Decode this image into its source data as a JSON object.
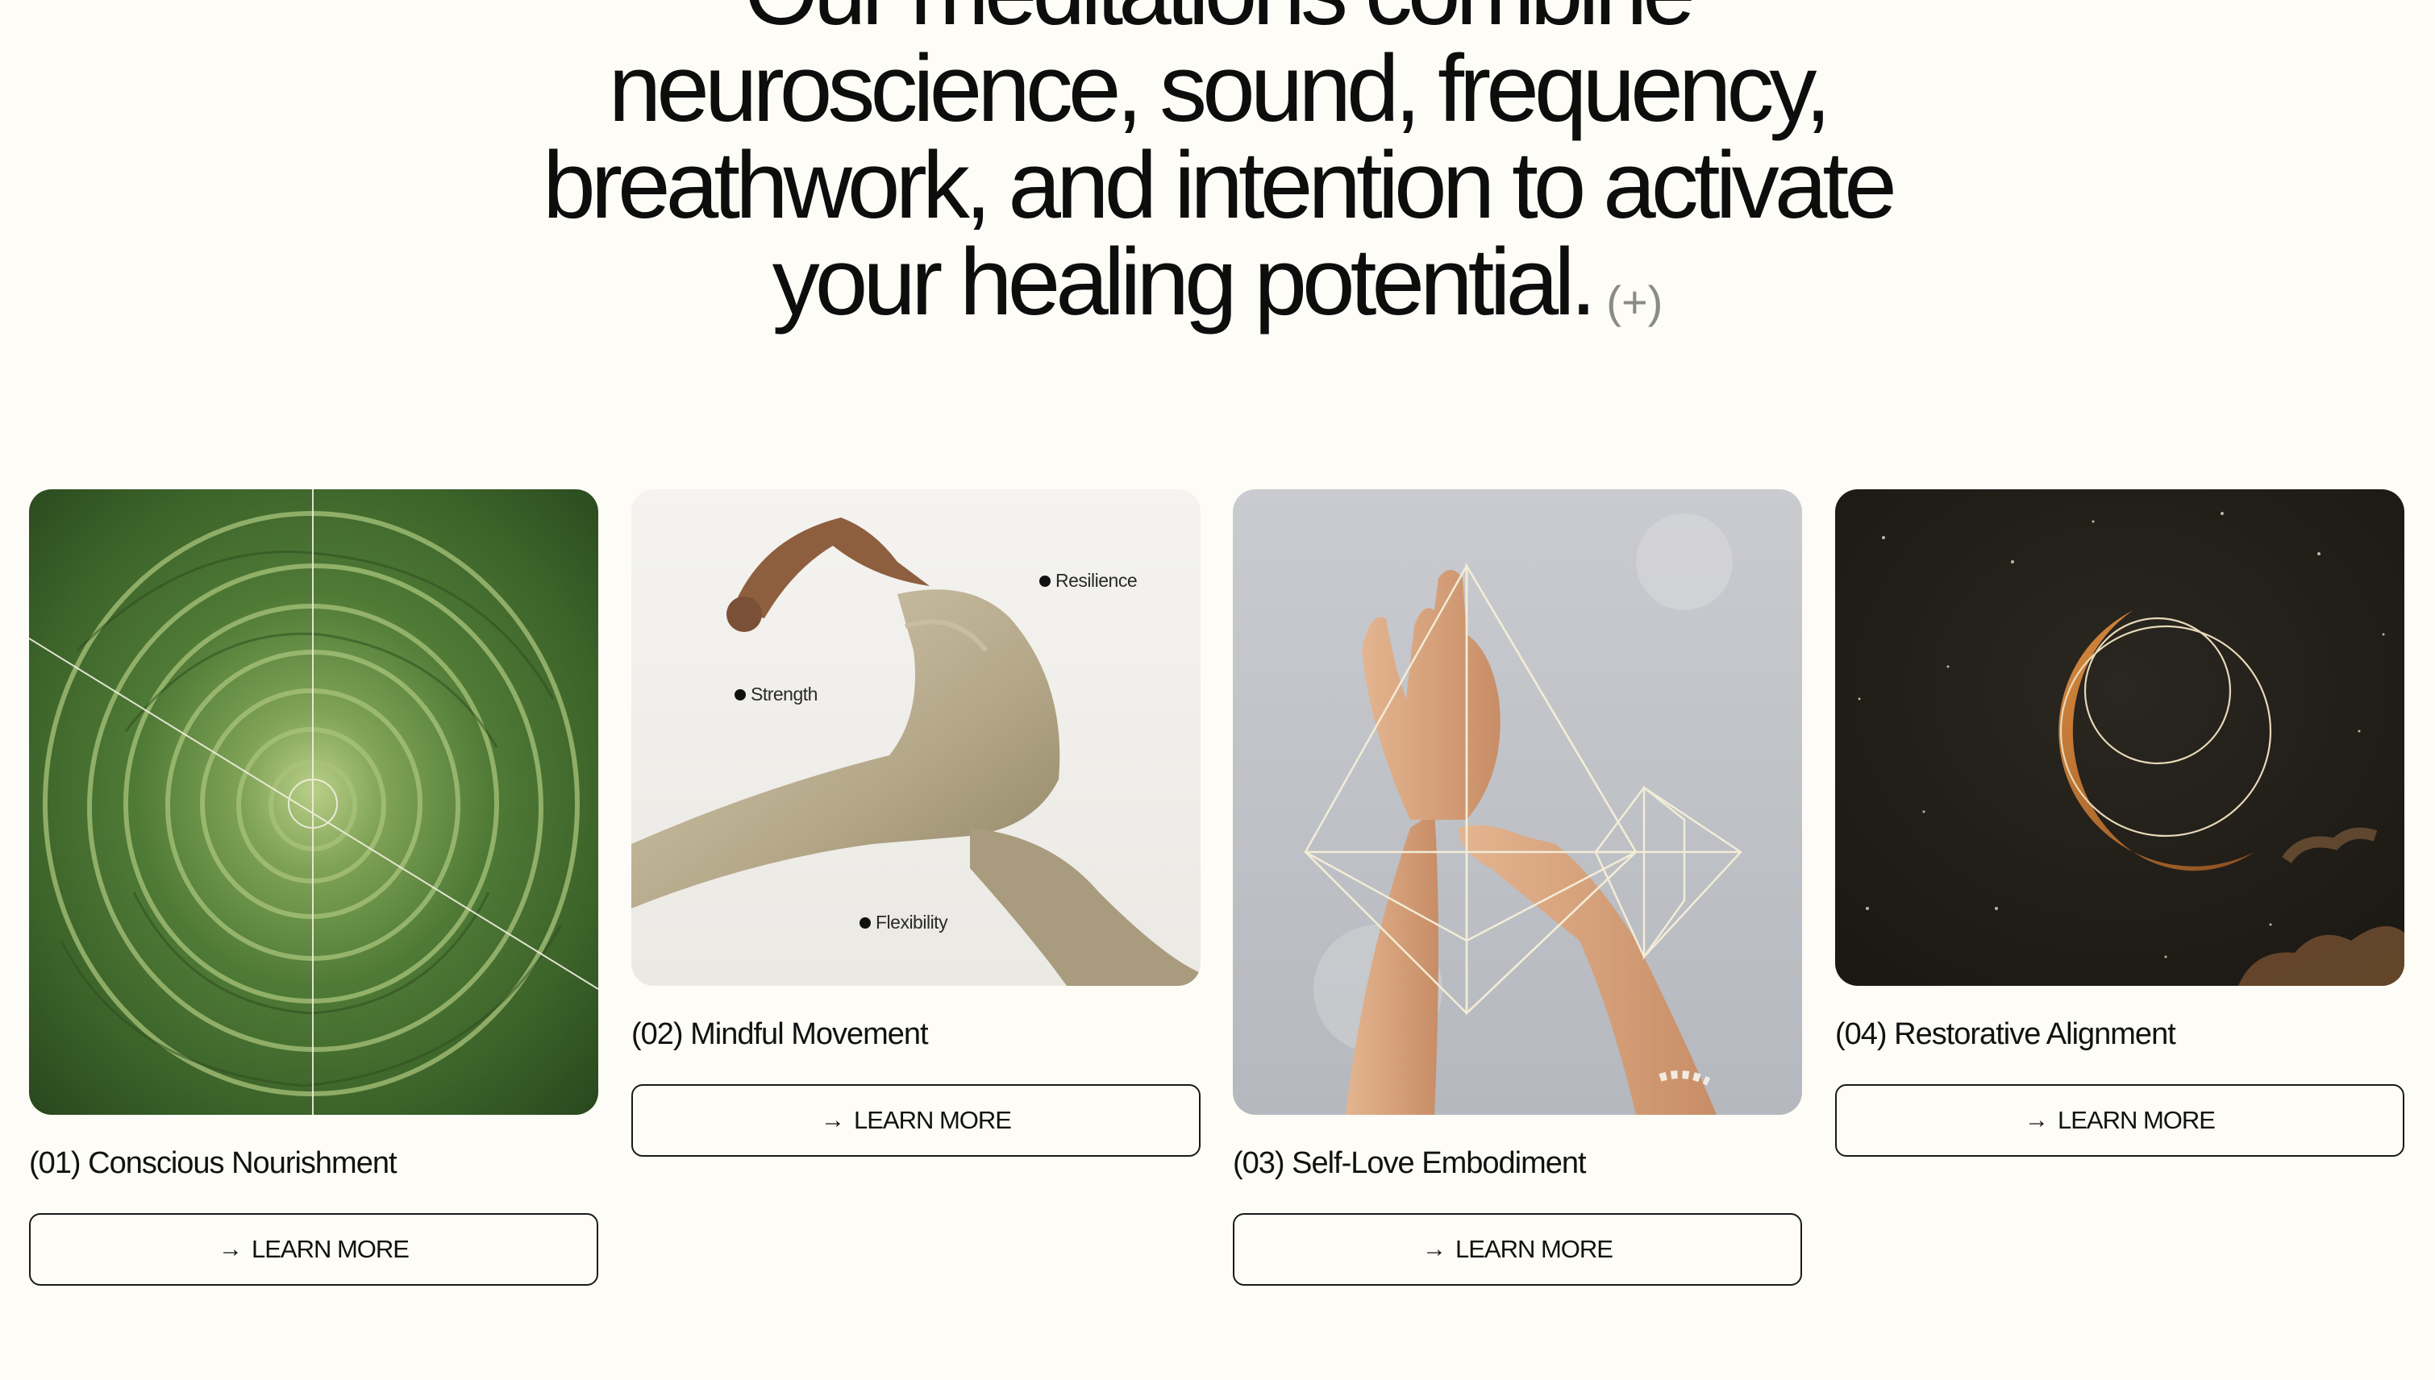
{
  "headline": {
    "lines": [
      "Our meditations combine",
      "neuroscience, sound, frequency,",
      "breathwork, and intention to activate",
      "your healing potential."
    ],
    "plus_label": "(+)"
  },
  "cards": [
    {
      "title": "(01) Conscious Nourishment",
      "button_label": "LEARN MORE",
      "button_icon": "arrow-right-icon",
      "image": "cabbage-rosette-with-geometric-lines"
    },
    {
      "title": "(02) Mindful Movement",
      "button_label": "LEARN MORE",
      "button_icon": "arrow-right-icon",
      "image": "person-in-leggings-stretching",
      "tags": [
        "Resilience",
        "Strength",
        "Flexibility"
      ]
    },
    {
      "title": "(03) Self-Love Embodiment",
      "button_label": "LEARN MORE",
      "button_icon": "arrow-right-icon",
      "image": "raised-hands-with-sacred-geometry"
    },
    {
      "title": "(04) Restorative Alignment",
      "button_label": "LEARN MORE",
      "button_icon": "arrow-right-icon",
      "image": "crescent-moon-in-starry-sky"
    }
  ],
  "colors": {
    "background": "#fdfcf6",
    "text": "#0d0d0d",
    "muted": "#8a8a86",
    "button_border": "#1a1a1a"
  }
}
